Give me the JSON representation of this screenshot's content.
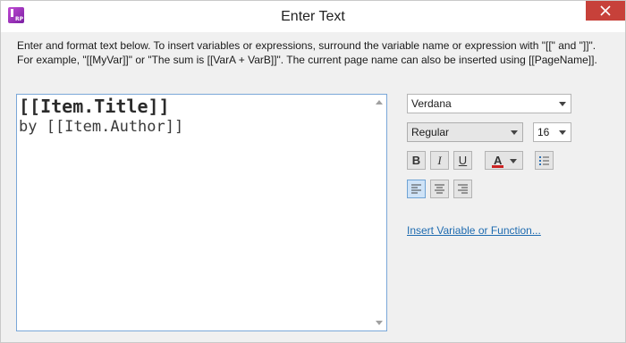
{
  "window": {
    "title": "Enter Text",
    "app_icon_text": "RP"
  },
  "description": "Enter and format text below. To insert variables or expressions, surround the variable name or expression with \"[[\" and \"]]\". For example, \"[[MyVar]]\" or \"The sum is [[VarA + VarB]]\". The current page name can also be inserted using [[PageName]].",
  "editor": {
    "line1": "[[Item.Title]]",
    "line2": "by [[Item.Author]]"
  },
  "formatting": {
    "font_family": "Verdana",
    "font_style": "Regular",
    "font_size": "16",
    "bold_label": "B",
    "italic_label": "I",
    "underline_label": "U",
    "font_color_label": "A",
    "font_color_bar": "#cc2222"
  },
  "alignment": {
    "selected": "left"
  },
  "insert_link": "Insert Variable or Function...",
  "colors": {
    "close_button": "#c7413a",
    "editor_border": "#7aa7d8",
    "link": "#1e6bb0",
    "active_toggle": "#cfe3f7"
  }
}
